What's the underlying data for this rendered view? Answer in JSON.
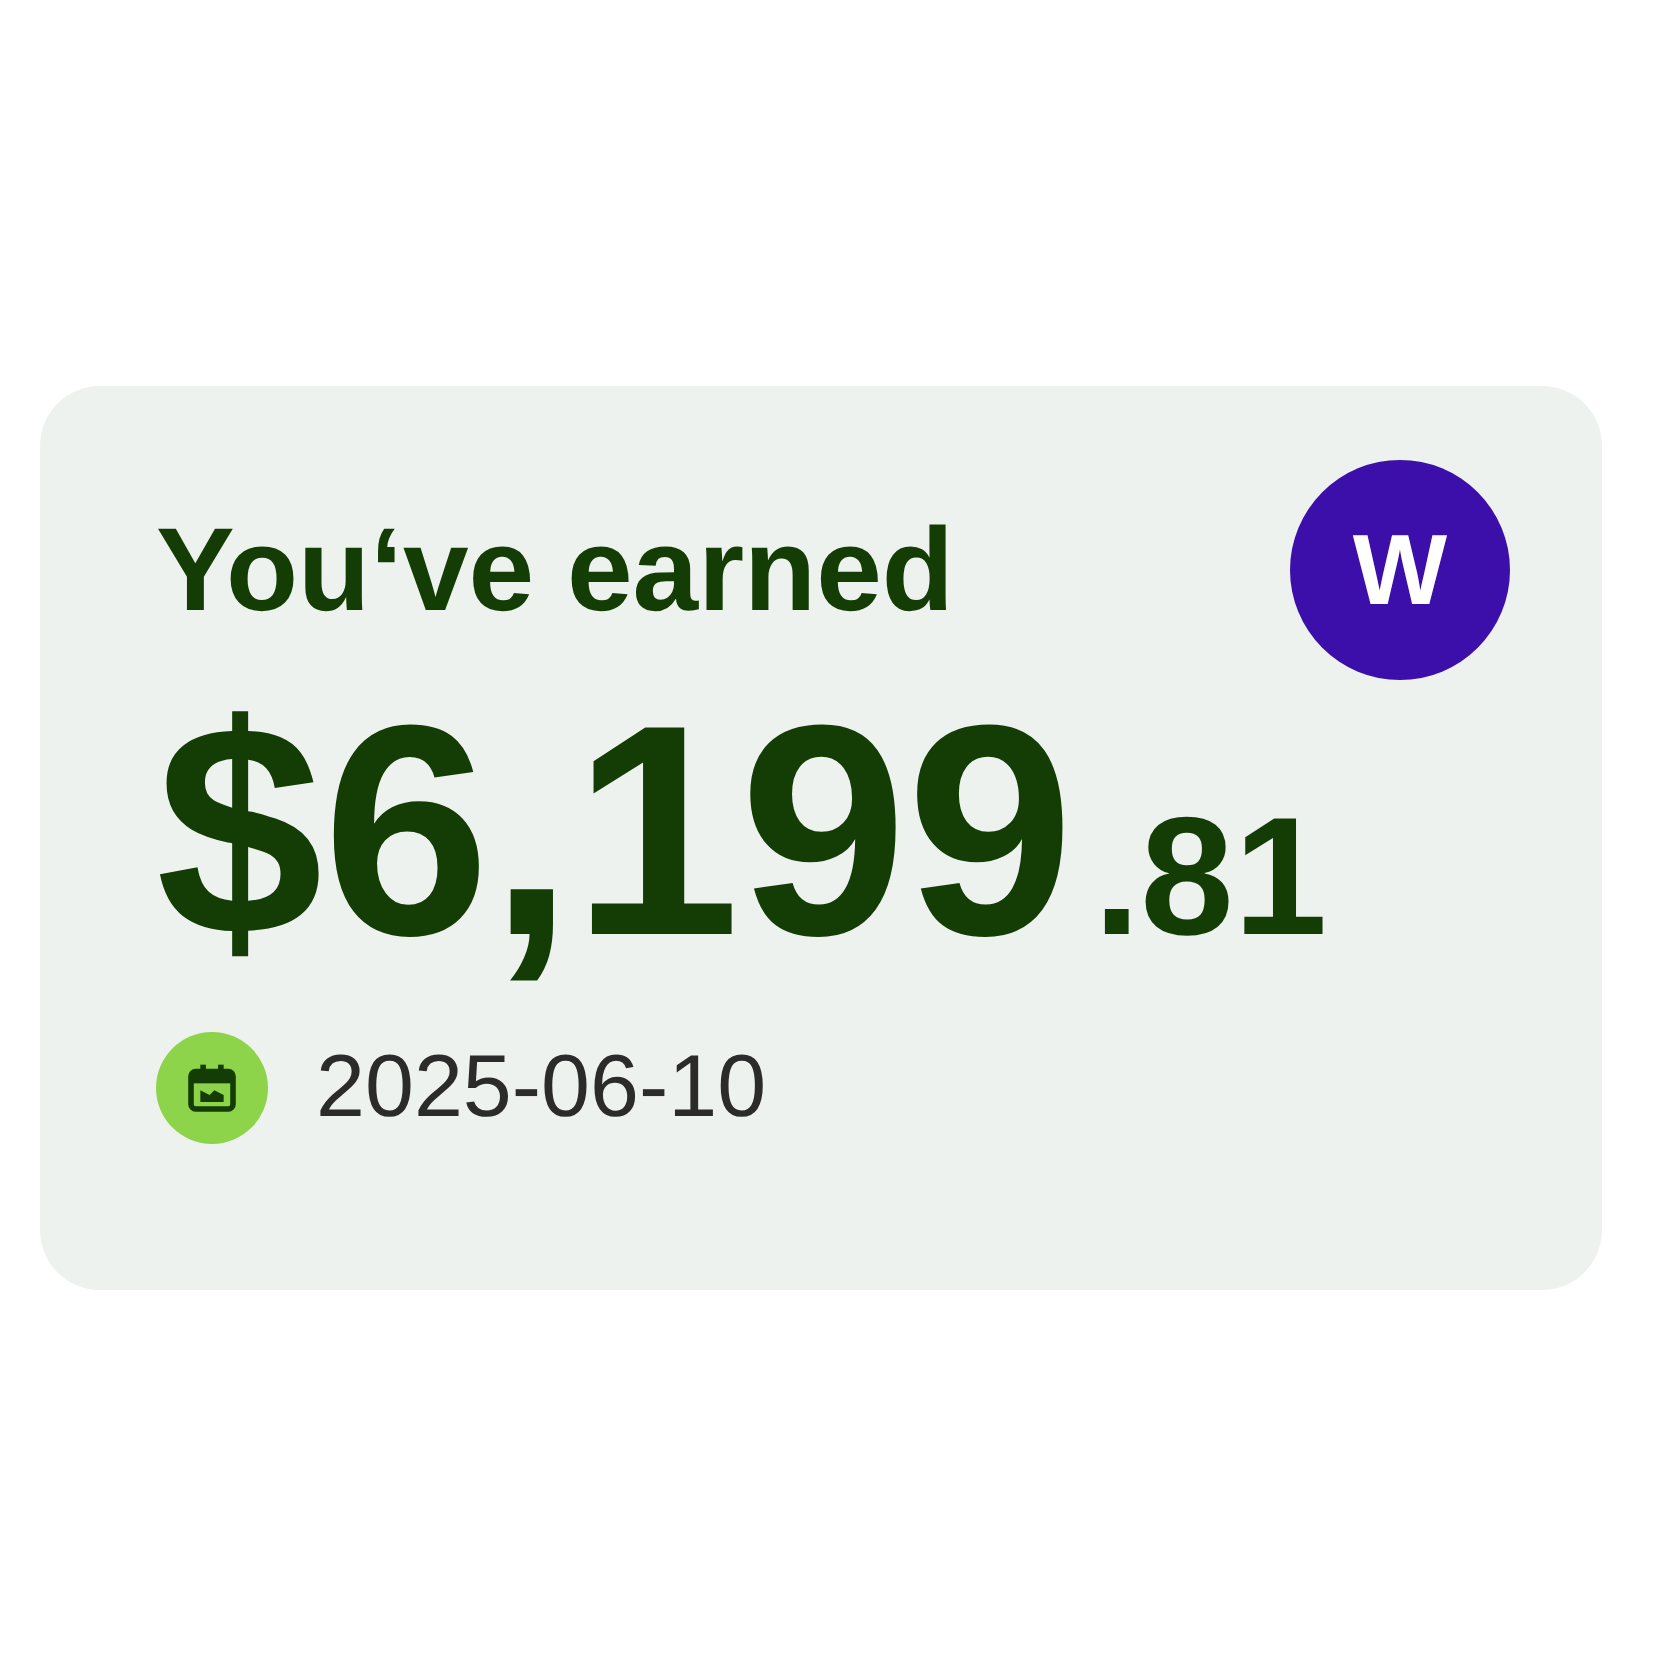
{
  "card": {
    "title": "You‘ve earned",
    "avatar": "W",
    "amount": {
      "main": "$6,199",
      "cents": ".81"
    },
    "date": "2025-06-10"
  }
}
